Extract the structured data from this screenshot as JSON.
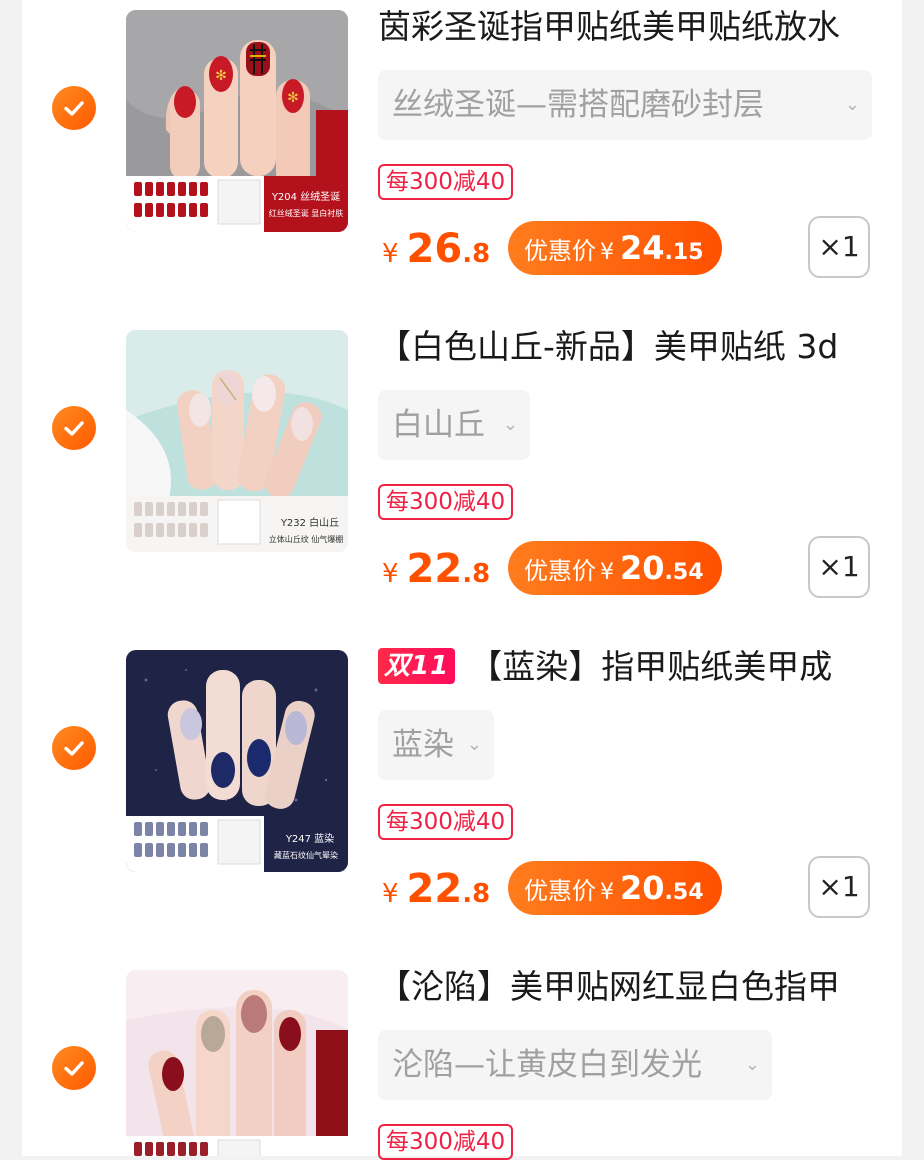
{
  "items": [
    {
      "title": "茵彩圣诞指甲贴纸美甲贴纸放水",
      "badge": "",
      "variant": "丝绒圣诞—需搭配磨砂封层",
      "promo": "每300减40",
      "price_currency": "¥",
      "price_int": "26",
      "price_dec": ".8",
      "deal_label": "优惠价",
      "deal_currency": "¥",
      "deal_int": "24",
      "deal_dec": ".15",
      "qty": "×1",
      "thumb_caption1": "Y204 丝绒圣诞",
      "thumb_caption2": "红丝绒圣诞 显白衬肤"
    },
    {
      "title": "【白色山丘-新品】美甲贴纸 3d",
      "badge": "",
      "variant": "白山丘",
      "promo": "每300减40",
      "price_currency": "¥",
      "price_int": "22",
      "price_dec": ".8",
      "deal_label": "优惠价",
      "deal_currency": "¥",
      "deal_int": "20",
      "deal_dec": ".54",
      "qty": "×1",
      "thumb_caption1": "Y232 白山丘",
      "thumb_caption2": "立体山丘纹 仙气爆棚"
    },
    {
      "title": "【蓝染】指甲贴纸美甲成",
      "badge": "双11",
      "variant": "蓝染",
      "promo": "每300减40",
      "price_currency": "¥",
      "price_int": "22",
      "price_dec": ".8",
      "deal_label": "优惠价",
      "deal_currency": "¥",
      "deal_int": "20",
      "deal_dec": ".54",
      "qty": "×1",
      "thumb_caption1": "Y247 蓝染",
      "thumb_caption2": "藏蓝石纹仙气晕染"
    },
    {
      "title": "【沦陷】美甲贴网红显白色指甲",
      "badge": "",
      "variant": "沦陷—让黄皮白到发光",
      "promo": "每300减40",
      "qty": ""
    }
  ],
  "icons": {
    "check": "checkmark-circle-icon",
    "chevron": "chevron-down-icon"
  },
  "colors": {
    "accent": "#ff5000",
    "promo": "#ee2244",
    "check": "#ff6a00"
  }
}
